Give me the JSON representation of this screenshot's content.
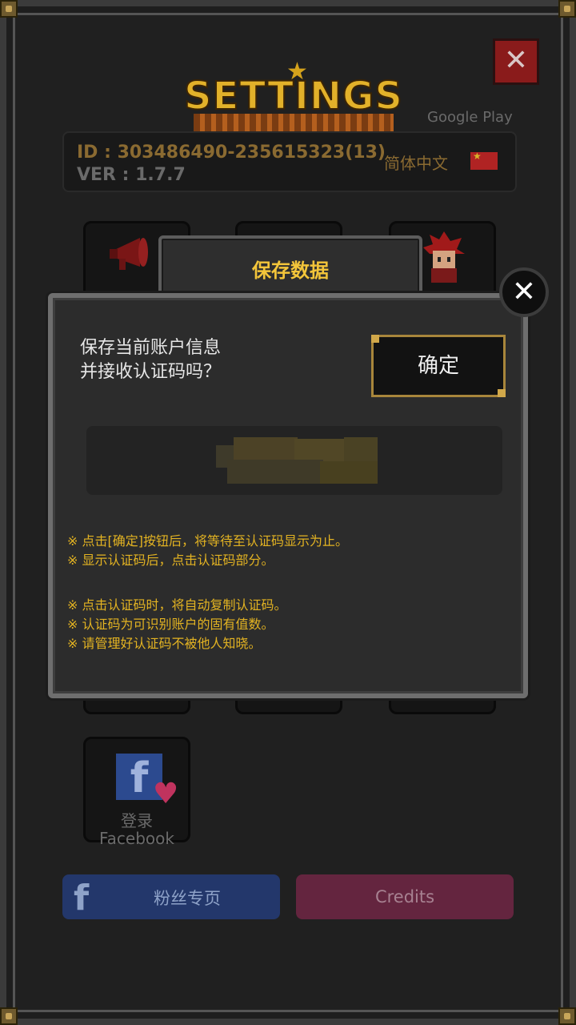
{
  "settings": {
    "title": "SETTINGS",
    "store_label": "Google Play",
    "close_icon": "✕",
    "id_line": "ID : 303486490-235615323(13)",
    "version_line": "VER : 1.7.7",
    "language": "简体中文",
    "facebook_tile": {
      "line1": "登录",
      "line2": "Facebook"
    },
    "fanpage_button": "粉丝专页",
    "credits_button": "Credits"
  },
  "dialog": {
    "title": "保存数据",
    "prompt_line1": "保存当前账户信息",
    "prompt_line2": "并接收认证码吗？",
    "confirm_button": "确定",
    "close_icon": "✕",
    "notes": [
      "※ 点击[确定]按钮后，将等待至认证码显示为止。",
      "※ 显示认证码后，点击认证码部分。",
      "※ 点击认证码时，将自动复制认证码。",
      "※ 认证码为可识别账户的固有值数。",
      "※ 请管理好认证码不被他人知晓。"
    ]
  },
  "colors": {
    "accent_gold": "#f3c53a",
    "note_yellow": "#e3b322",
    "facebook_blue": "#23376b",
    "credits_magenta": "#64253f"
  }
}
